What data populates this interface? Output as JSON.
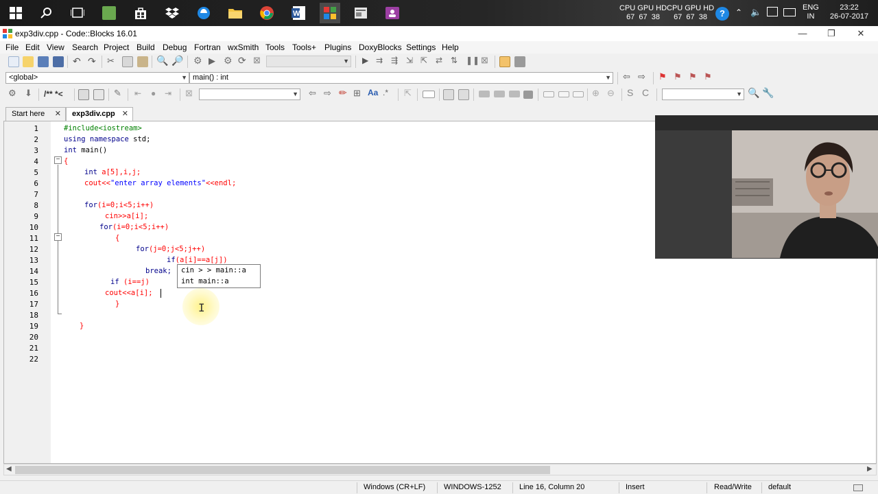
{
  "taskbar": {
    "apps": [
      {
        "icon": "windows-start-icon"
      },
      {
        "icon": "search-icon"
      },
      {
        "icon": "task-view-icon"
      },
      {
        "icon": "app-green-icon"
      },
      {
        "icon": "store-icon"
      },
      {
        "icon": "dropbox-icon"
      },
      {
        "icon": "edge-icon"
      },
      {
        "icon": "file-explorer-icon"
      },
      {
        "icon": "chrome-icon"
      },
      {
        "icon": "word-icon"
      },
      {
        "icon": "codeblocks-icon"
      },
      {
        "icon": "app-window-icon"
      },
      {
        "icon": "app-purple-icon"
      }
    ],
    "monitor1": {
      "header": "CPU GPU HD",
      "values": "67  67  38"
    },
    "monitor2": {
      "header": "CPU GPU HD",
      "values": "67  67  38"
    },
    "lang": "ENG",
    "region": "IN",
    "time": "23:22",
    "date": "26-07-2017"
  },
  "window": {
    "title": "exp3div.cpp - Code::Blocks 16.01",
    "minimize": "—",
    "restore": "❐",
    "close": "✕"
  },
  "menu": [
    "File",
    "Edit",
    "View",
    "Search",
    "Project",
    "Build",
    "Debug",
    "Fortran",
    "wxSmith",
    "Tools",
    "Tools+",
    "Plugins",
    "DoxyBlocks",
    "Settings",
    "Help"
  ],
  "toolbar": {
    "scope_combo": "<global>",
    "function_combo": "main() : int",
    "doxy_comment": "/** *<"
  },
  "tabs": [
    {
      "label": "Start here",
      "close": "✕"
    },
    {
      "label": "exp3div.cpp",
      "close": "✕"
    }
  ],
  "editor": {
    "line_numbers": [
      "1",
      "2",
      "3",
      "4",
      "5",
      "6",
      "7",
      "8",
      "9",
      "10",
      "11",
      "12",
      "13",
      "14",
      "15",
      "16",
      "17",
      "18",
      "19",
      "20",
      "21",
      "22"
    ],
    "code": {
      "l1": "#include<iostream>",
      "l2a": "using namespace ",
      "l2b": "std;",
      "l3a": "int",
      "l3b": " main()",
      "l4": "{",
      "l5a": "int",
      "l5b": " a[5],i,j;",
      "l6a": "cout<<",
      "l6b": "\"enter array elements\"",
      "l6c": "<<endl;",
      "l8a": "for",
      "l8b": "(i=0;i<5;i++)",
      "l9": "cin>>a[i];",
      "l10a": "for",
      "l10b": "(i=0;i<5;i++)",
      "l11": "{",
      "l12a": "for",
      "l12b": "(j=0;j<5;j++)",
      "l13a": "if",
      "l13b": "(a[i]==a[j])",
      "l14": "break;",
      "l15a": "if",
      "l15b": " (i==j)",
      "l16": "cout<<a[i];",
      "l17": "}",
      "l19": "}"
    },
    "autocomplete": [
      "cin > > main::a",
      "int main::a"
    ]
  },
  "status": {
    "eol": "Windows (CR+LF)",
    "encoding": "WINDOWS-1252",
    "position": "Line 16, Column 20",
    "mode": "Insert",
    "access": "Read/Write",
    "profile": "default"
  }
}
